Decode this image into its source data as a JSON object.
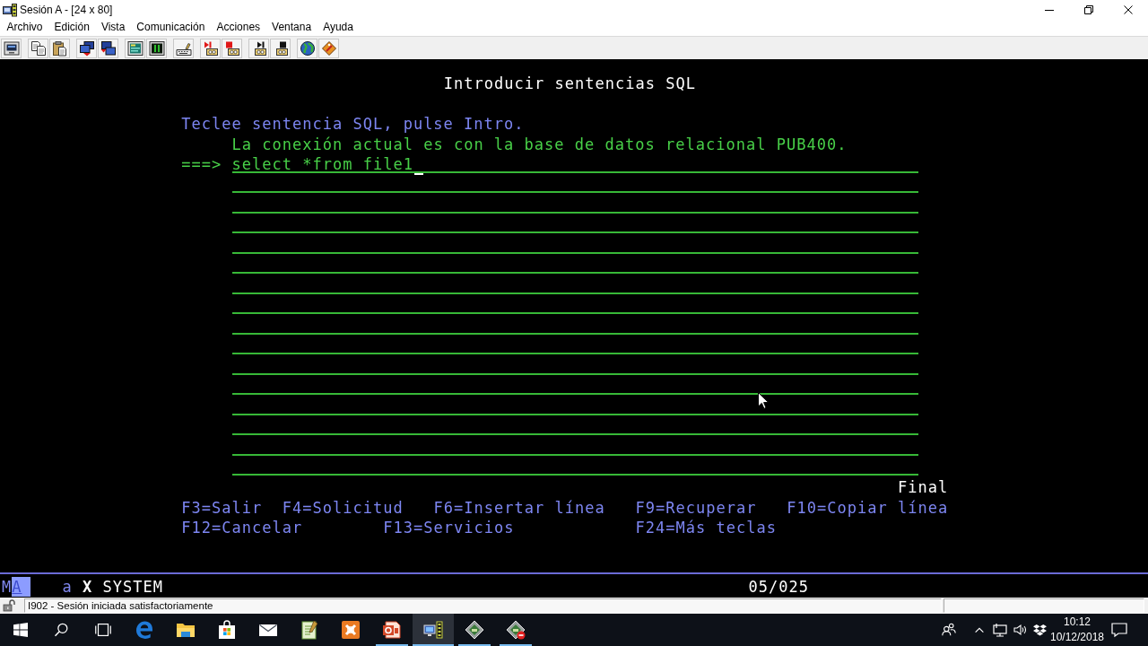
{
  "window": {
    "title": "Sesión A - [24 x 80]"
  },
  "menu_bar": [
    {
      "label": "Archivo"
    },
    {
      "label": "Edición"
    },
    {
      "label": "Vista"
    },
    {
      "label": "Comunicación"
    },
    {
      "label": "Acciones"
    },
    {
      "label": "Ventana"
    },
    {
      "label": "Ayuda"
    }
  ],
  "terminal": {
    "screen_title": "Introducir sentencias SQL",
    "instruction": "Teclee sentencia SQL, pulse Intro.",
    "connection_info": "La conexión actual es con la base de datos relacional PUB400.",
    "prompt": "===>",
    "sql_input": {
      "value": "select *from file1",
      "cursor": true
    },
    "more_indicator": "Final",
    "function_keys": [
      [
        "F3=Salir",
        "F4=Solicitud",
        "F6=Insertar línea",
        "F9=Recuperar",
        "F10=Copiar línea"
      ],
      [
        "F12=Cancelar",
        "F13=Servicios",
        "F24=Más teclas"
      ]
    ]
  },
  "status_line": {
    "items": [
      {
        "text": "M",
        "kind": "normal"
      },
      {
        "text": "A",
        "kind": "reverse"
      },
      {
        "text": "a",
        "kind": "normal"
      },
      {
        "text": "X",
        "kind": "symbol"
      },
      {
        "text": "SYSTEM",
        "kind": "bright"
      }
    ],
    "cursor_position": "05/025"
  },
  "status_bar": {
    "message": "I902 - Sesión iniciada satisfactoriamente"
  },
  "taskbar": {
    "apps": [
      {
        "kind": "browser",
        "open": false,
        "active": false
      },
      {
        "kind": "files",
        "open": false,
        "active": false
      },
      {
        "kind": "store",
        "open": false,
        "active": false
      },
      {
        "kind": "mail",
        "open": false,
        "active": false
      },
      {
        "kind": "notes",
        "open": false,
        "active": false
      },
      {
        "kind": "stack",
        "open": false,
        "active": false
      },
      {
        "kind": "slides",
        "open": true,
        "active": false
      },
      {
        "kind": "terminal",
        "open": true,
        "active": true
      },
      {
        "kind": "gem",
        "open": true,
        "active": false
      },
      {
        "kind": "gemstop",
        "open": true,
        "active": false
      }
    ],
    "clock": {
      "time": "10:12",
      "date": "10/12/2018"
    }
  }
}
